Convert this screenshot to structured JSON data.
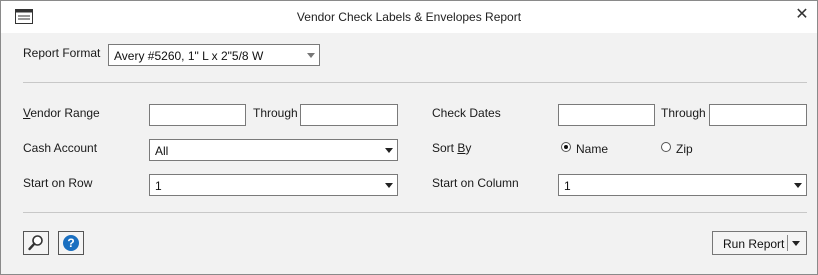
{
  "window": {
    "title": "Vendor Check Labels & Envelopes Report",
    "close_glyph": "✕"
  },
  "report_format": {
    "label": "Report Format",
    "value": "Avery #5260, 1\" L x 2\"5/8 W"
  },
  "vendor_range": {
    "label_first": "V",
    "label_rest": "endor Range",
    "from_value": "",
    "through_label": "Through",
    "through_value": ""
  },
  "check_dates": {
    "label": "Check Dates",
    "from_value": "",
    "through_label": "Through",
    "through_value": ""
  },
  "cash_account": {
    "label": "Cash Account",
    "value": "All"
  },
  "sort_by": {
    "label_start": "Sort ",
    "label_underlined": "B",
    "label_end": "y",
    "options": [
      {
        "label": "Name",
        "checked": true
      },
      {
        "label": "Zip",
        "checked": false
      }
    ]
  },
  "start_on_row": {
    "label": "Start on Row",
    "value": "1"
  },
  "start_on_column": {
    "label": "Start on Column",
    "value": "1"
  },
  "footer": {
    "preview_icon": "magnifier-icon",
    "help_icon": "help-icon",
    "run_report_label": "Run Report"
  },
  "colors": {
    "help_blue": "#1a6fc0",
    "window_bg": "#f2f2f2"
  }
}
